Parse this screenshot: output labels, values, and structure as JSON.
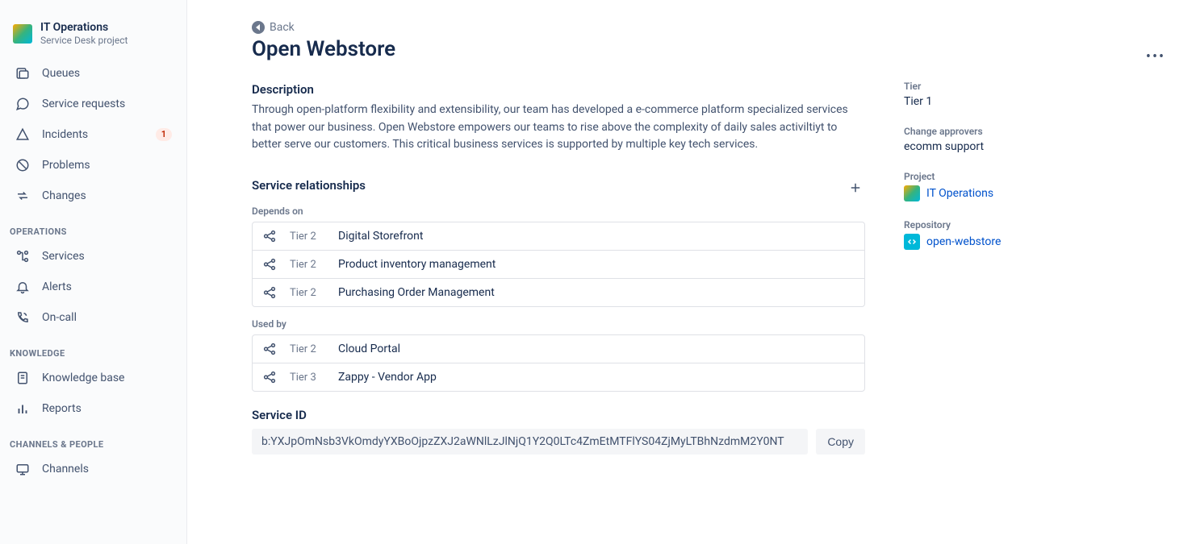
{
  "sidebar": {
    "project_name": "IT Operations",
    "project_type": "Service Desk project",
    "items_main": [
      {
        "icon": "queues",
        "label": "Queues"
      },
      {
        "icon": "service-requests",
        "label": "Service requests"
      },
      {
        "icon": "incidents",
        "label": "Incidents",
        "badge": "1"
      },
      {
        "icon": "problems",
        "label": "Problems"
      },
      {
        "icon": "changes",
        "label": "Changes"
      }
    ],
    "group_operations_label": "OPERATIONS",
    "items_operations": [
      {
        "icon": "services",
        "label": "Services"
      },
      {
        "icon": "alerts",
        "label": "Alerts"
      },
      {
        "icon": "on-call",
        "label": "On-call"
      }
    ],
    "group_knowledge_label": "KNOWLEDGE",
    "items_knowledge": [
      {
        "icon": "knowledge-base",
        "label": "Knowledge base"
      },
      {
        "icon": "reports",
        "label": "Reports"
      }
    ],
    "group_channels_label": "CHANNELS & PEOPLE",
    "items_channels": [
      {
        "icon": "channels",
        "label": "Channels"
      }
    ]
  },
  "content": {
    "back_label": "Back",
    "page_title": "Open Webstore",
    "description_heading": "Description",
    "description_text": "Through open-platform flexibility and extensibility, our team has developed a e-commerce platform specialized services that power our business. Open Webstore empowers our teams to rise above the complexity of daily sales activiltiyt to better serve our customers. This critical business services is supported by multiple key tech services.",
    "relationships_heading": "Service relationships",
    "depends_on_label": "Depends on",
    "depends_on": [
      {
        "tier": "Tier 2",
        "name": "Digital Storefront"
      },
      {
        "tier": "Tier 2",
        "name": "Product inventory management"
      },
      {
        "tier": "Tier 2",
        "name": "Purchasing Order Management"
      }
    ],
    "used_by_label": "Used by",
    "used_by": [
      {
        "tier": "Tier 2",
        "name": "Cloud Portal"
      },
      {
        "tier": "Tier 3",
        "name": "Zappy - Vendor App"
      }
    ],
    "service_id_heading": "Service ID",
    "service_id_value": "b:YXJpOmNsb3VkOmdyYXBoOjpzZXJ2aWNlLzJlNjQ1Y2Q0LTc4ZmEtMTFlYS04ZjMyLTBhNzdmM2Y0NT",
    "copy_label": "Copy"
  },
  "meta": {
    "tier_label": "Tier",
    "tier_value": "Tier 1",
    "approvers_label": "Change approvers",
    "approvers_value": "ecomm support",
    "project_label": "Project",
    "project_value": "IT Operations",
    "repository_label": "Repository",
    "repository_value": "open-webstore"
  }
}
